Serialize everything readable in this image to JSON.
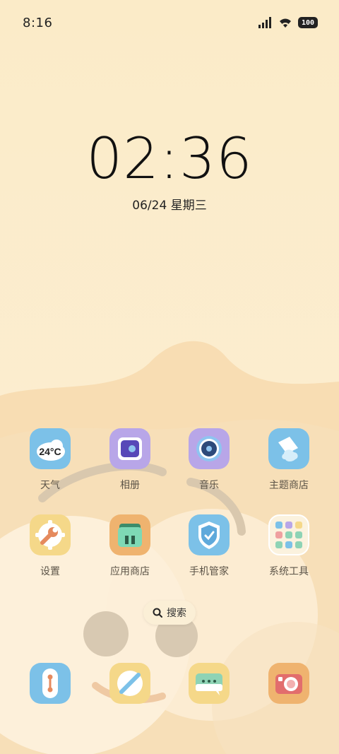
{
  "status_bar": {
    "time": "8:16",
    "battery": "100",
    "icons": [
      "signal-icon",
      "wifi-icon",
      "battery-icon"
    ]
  },
  "clock": {
    "time": "02:36",
    "date": "06/24 星期三"
  },
  "apps": [
    {
      "label": "天气",
      "icon": "weather-icon",
      "badge": "24°C"
    },
    {
      "label": "相册",
      "icon": "gallery-icon"
    },
    {
      "label": "音乐",
      "icon": "music-icon"
    },
    {
      "label": "主题商店",
      "icon": "theme-store-icon"
    },
    {
      "label": "设置",
      "icon": "settings-icon"
    },
    {
      "label": "应用商店",
      "icon": "app-store-icon"
    },
    {
      "label": "手机管家",
      "icon": "phone-manager-icon"
    },
    {
      "label": "系统工具",
      "icon": "system-tools-folder-icon"
    }
  ],
  "search": {
    "label": "搜索"
  },
  "dock": [
    {
      "icon": "phone-icon"
    },
    {
      "icon": "browser-icon"
    },
    {
      "icon": "messages-icon"
    },
    {
      "icon": "camera-icon"
    }
  ],
  "colors": {
    "background": "#FBEBC8",
    "text": "#5c5448",
    "blue": "#7CC1E8",
    "purple": "#B8A6E8",
    "yellow": "#F5D889",
    "orange": "#EFB36F"
  }
}
